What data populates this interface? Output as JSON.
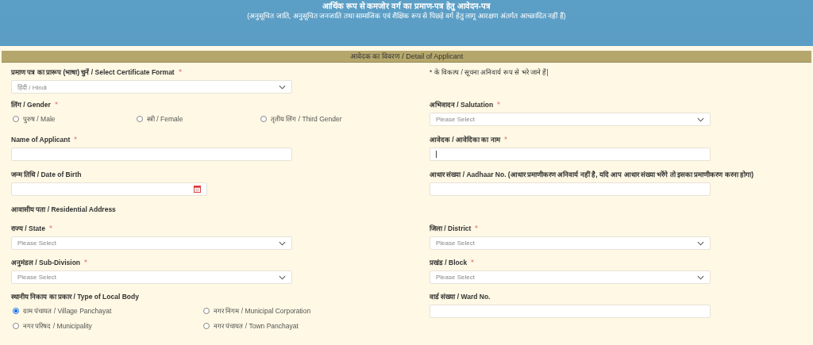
{
  "header": {
    "title": "आर्थिक रूप से कमजोर वर्ग का प्रमाण-पत्र हेतु आवेदन-पत्र",
    "subtitle": "(अनुसूचित जाति, अनुसूचित जनजाति तथा सामाजिक एवं शैक्षिक रूप से पिछड़े वर्ग हेतु लागू आरक्षण अंतर्गत आच्छादित नहीं हैं)"
  },
  "section_title": "आवेदक का विवरण / Detail of Applicant",
  "rows": [
    {
      "left": {
        "kind": "select",
        "label": "प्रमाण पत्र का प्रारूप (भाषा) चुनें / Select Certificate Format",
        "required": true,
        "value": "हिंदी / Hindi"
      },
      "right": {
        "kind": "note",
        "label": "* के विकल्प / सूचना अनिवार्य रूप से भरे जाने हैं|"
      }
    },
    {
      "left": {
        "kind": "radio",
        "label": "लिंग / Gender",
        "required": true,
        "options": [
          {
            "label": "पुरुष / Male",
            "selected": false
          },
          {
            "label": "स्त्री / Female",
            "selected": false
          },
          {
            "label": "तृतीय लिंग / Third Gender",
            "selected": false
          }
        ]
      },
      "right": {
        "kind": "select",
        "label": "अभिवादन / Salutation",
        "required": true,
        "placeholder": "Please Select"
      }
    },
    {
      "left": {
        "kind": "text",
        "label": "Name of Applicant",
        "required": true
      },
      "right": {
        "kind": "text",
        "label": "आवेदक / आवेदिका का नाम",
        "required": true,
        "focused": true
      }
    },
    {
      "left": {
        "kind": "date",
        "label": "जन्म तिथि / Date of Birth",
        "required": false
      },
      "right": {
        "kind": "text",
        "label": "आधार संख्या / Aadhaar No. (आधार प्रमाणीकरण अनिवार्य नहीं है, यदि आप आधार संख्या भरेंगे तो इसका प्रमाणीकरण करना होगा)",
        "required": false
      }
    },
    {
      "left": {
        "kind": "heading",
        "label": "आवासीय पता / Residential Address"
      }
    },
    {
      "left": {
        "kind": "select",
        "label": "राज्य / State",
        "required": true,
        "placeholder": "Please Select"
      },
      "right": {
        "kind": "select",
        "label": "जिला / District",
        "required": true,
        "placeholder": "Please Select"
      }
    },
    {
      "left": {
        "kind": "select",
        "label": "अनुमंडल / Sub-Division",
        "required": true,
        "placeholder": "Please Select"
      },
      "right": {
        "kind": "select",
        "label": "प्रखंड / Block",
        "required": true,
        "placeholder": "Please Select"
      }
    },
    {
      "left": {
        "kind": "radio",
        "label": "स्थानीय निकाय का प्रकार / Type of Local Body",
        "required": false,
        "options": [
          {
            "label": "ग्राम पंचायत / Village Panchayat",
            "selected": true
          },
          {
            "label": "नगर निगम / Municipal Corporation",
            "selected": false
          },
          {
            "label": "नगर परिषद / Municipality",
            "selected": false
          },
          {
            "label": "नगर पंचायत / Town Panchayat",
            "selected": false
          }
        ]
      },
      "right": {
        "kind": "text",
        "label": "वार्ड संख्या / Ward No.",
        "required": false
      }
    }
  ]
}
